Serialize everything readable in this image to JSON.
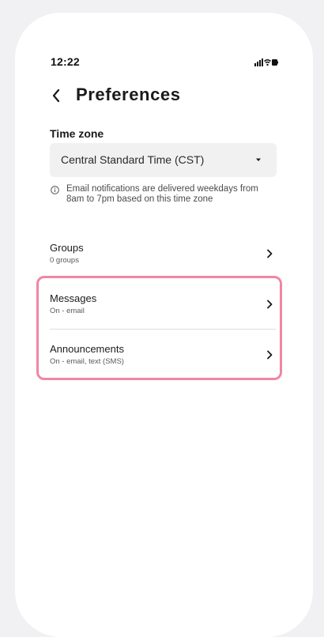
{
  "status_bar": {
    "time": "12:22",
    "icons": [
      "signal-icon",
      "wifi-icon",
      "battery-icon"
    ]
  },
  "header": {
    "back_icon": "chevron-left-icon",
    "title": "Preferences"
  },
  "time_zone": {
    "label": "Time zone",
    "selected": "Central Standard Time (CST)",
    "caret_icon": "caret-down-icon",
    "info_icon": "info-icon",
    "info_text": "Email notifications are delivered weekdays from 8am to 7pm based on this time zone"
  },
  "rows": [
    {
      "title": "Groups",
      "subtitle": "0 groups",
      "icon": "chevron-right-icon"
    },
    {
      "title": "Messages",
      "subtitle": "On - email",
      "icon": "chevron-right-icon"
    },
    {
      "title": "Announcements",
      "subtitle": "On - email, text (SMS)",
      "icon": "chevron-right-icon"
    }
  ],
  "colors": {
    "highlight": "#ef86a4",
    "background": "#f1f1f3",
    "select_bg": "#f1f1f1",
    "text": "#1c1c1e"
  }
}
